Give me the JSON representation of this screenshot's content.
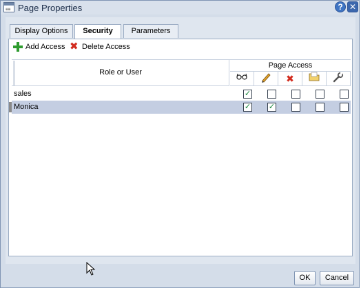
{
  "window": {
    "title": "Page Properties",
    "help_label": "?",
    "close_label": "✕"
  },
  "tabs": [
    {
      "label": "Display Options"
    },
    {
      "label": "Security",
      "active": true
    },
    {
      "label": "Parameters"
    }
  ],
  "toolbar": {
    "add_label": "Add Access",
    "delete_label": "Delete Access"
  },
  "table": {
    "role_header": "Role or User",
    "access_header": "Page Access",
    "access_columns": [
      {
        "icon": "glasses-icon",
        "meaning": "view"
      },
      {
        "icon": "pencil-icon",
        "meaning": "edit"
      },
      {
        "icon": "red-x-icon",
        "meaning": "delete"
      },
      {
        "icon": "folder-icon",
        "meaning": "manage"
      },
      {
        "icon": "wrench-icon",
        "meaning": "customize"
      }
    ],
    "rows": [
      {
        "name": "sales",
        "selected": false,
        "access": [
          true,
          false,
          false,
          false,
          false
        ]
      },
      {
        "name": "Monica",
        "selected": true,
        "access": [
          true,
          true,
          false,
          false,
          false
        ]
      }
    ]
  },
  "footer": {
    "ok_label": "OK",
    "cancel_label": "Cancel"
  },
  "colors": {
    "check": "#16853a",
    "selected_row": "#c4cee2",
    "dialog_bg": "#d4dde9"
  }
}
